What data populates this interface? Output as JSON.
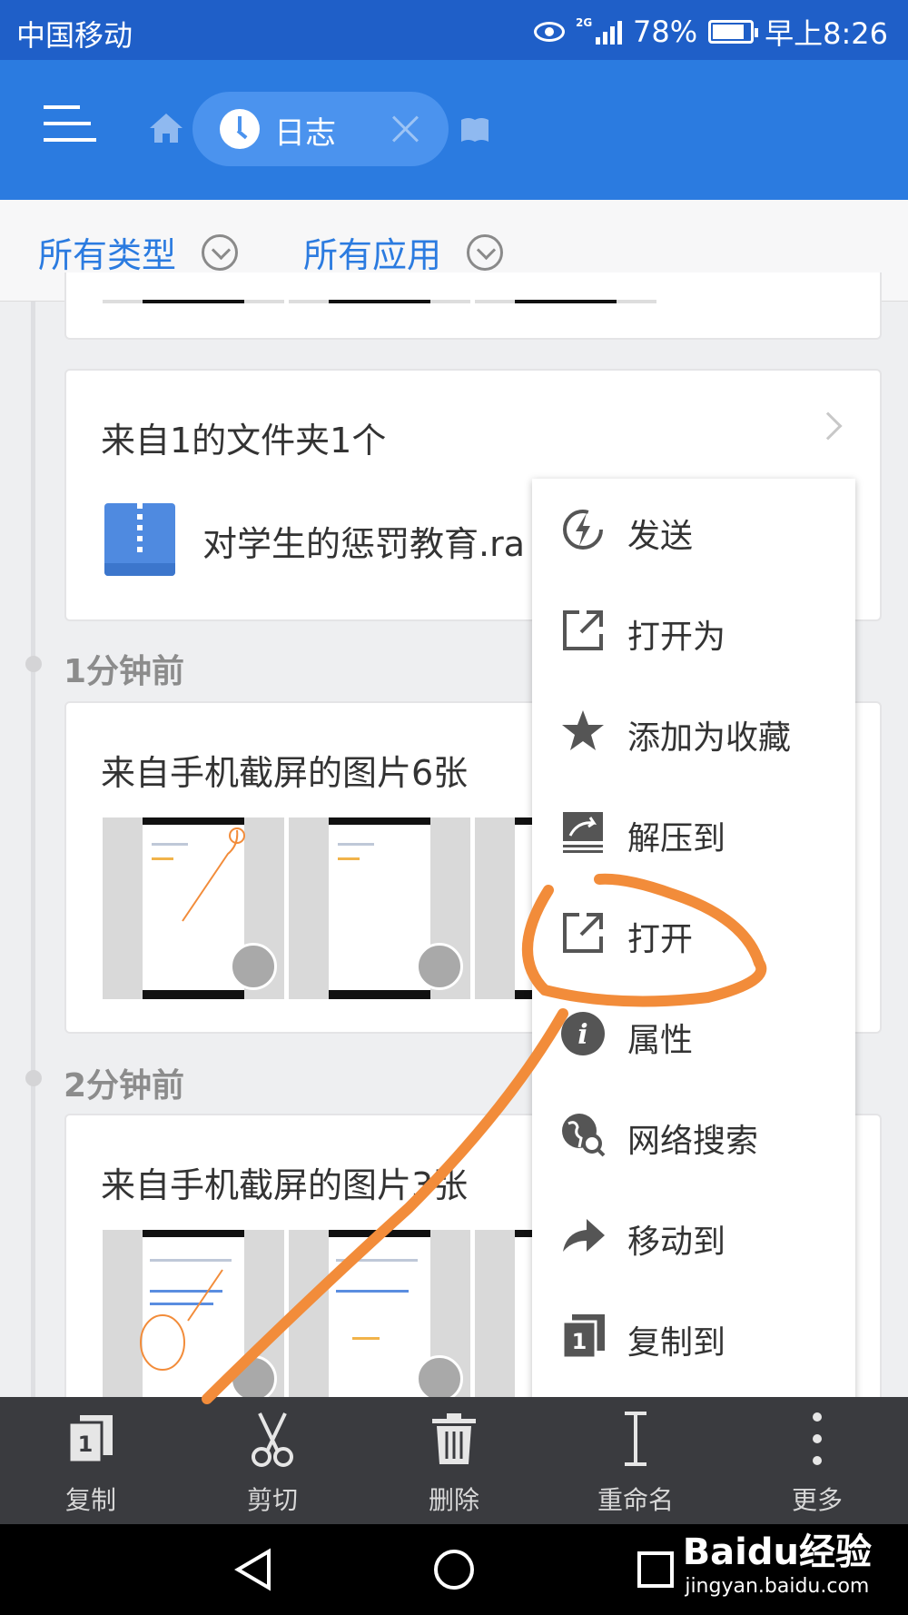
{
  "status_bar": {
    "carrier": "中国移动",
    "network": "2G",
    "battery": "78%",
    "time": "早上8:26"
  },
  "app_bar": {
    "breadcrumb_label": "日志"
  },
  "filters": {
    "type_filter": "所有类型",
    "app_filter": "所有应用"
  },
  "timeline": [
    {
      "group": "folder",
      "title": "来自1的文件夹1个",
      "file_name": "对学生的惩罚教育.ra"
    },
    {
      "time_label": "1分钟前",
      "title": "来自手机截屏的图片6张"
    },
    {
      "time_label": "2分钟前",
      "title": "来自手机截屏的图片3张"
    }
  ],
  "context_menu": {
    "items": [
      {
        "label": "发送",
        "icon": "send-icon"
      },
      {
        "label": "打开为",
        "icon": "open-external-icon"
      },
      {
        "label": "添加为收藏",
        "icon": "star-icon"
      },
      {
        "label": "解压到",
        "icon": "extract-icon"
      },
      {
        "label": "打开",
        "icon": "open-external-icon"
      },
      {
        "label": "属性",
        "icon": "info-icon"
      },
      {
        "label": "网络搜索",
        "icon": "web-search-icon"
      },
      {
        "label": "移动到",
        "icon": "move-icon"
      },
      {
        "label": "复制到",
        "icon": "copy-to-icon"
      }
    ]
  },
  "toolbar": {
    "items": [
      {
        "label": "复制",
        "icon": "copy-icon"
      },
      {
        "label": "剪切",
        "icon": "scissors-icon"
      },
      {
        "label": "删除",
        "icon": "trash-icon"
      },
      {
        "label": "重命名",
        "icon": "rename-icon"
      },
      {
        "label": "更多",
        "icon": "more-icon"
      }
    ]
  },
  "watermark": {
    "brand": "Baidu经验",
    "url": "jingyan.baidu.com"
  },
  "colors": {
    "status_bar": "#1f5fc8",
    "app_bar": "#2b7be0",
    "accent": "#2b7be0",
    "annotation": "#f28c3a",
    "toolbar": "#3a3b3f"
  }
}
